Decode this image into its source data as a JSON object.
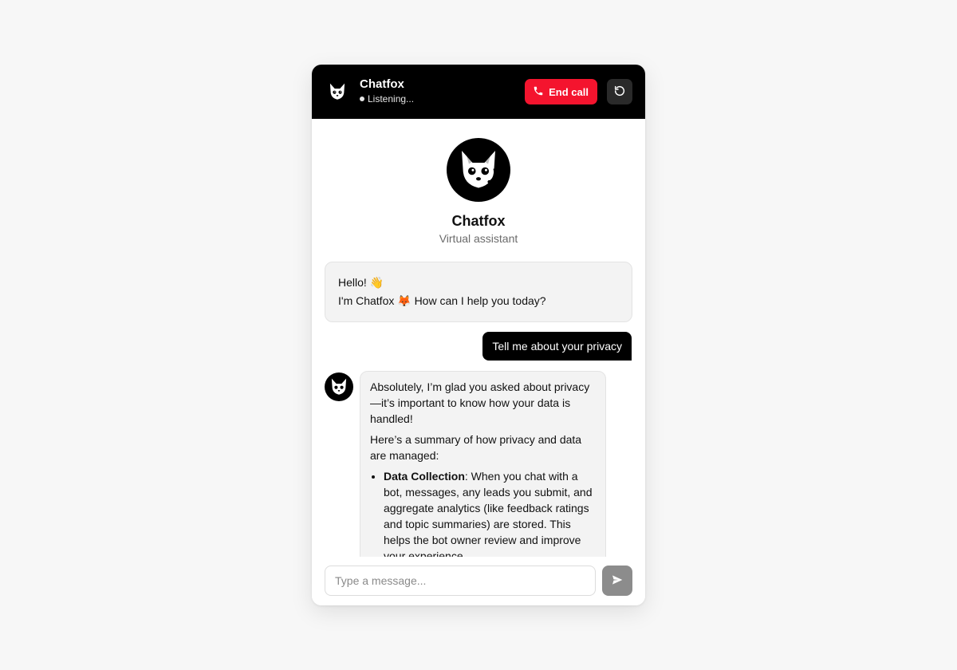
{
  "colors": {
    "header_bg": "#000000",
    "end_call_bg": "#f4142e",
    "user_bubble_bg": "#000000",
    "bot_bubble_bg": "#f3f3f3",
    "send_button_bg": "#8c8c8c",
    "page_bg": "#f7f7f7"
  },
  "header": {
    "title": "Chatfox",
    "status": "Listening...",
    "logo_icon": "fox-mascot-icon",
    "end_call_label": "End call",
    "end_call_icon": "phone-icon",
    "reset_icon": "refresh-icon"
  },
  "profile": {
    "avatar_icon": "fox-mascot-icon",
    "name": "Chatfox",
    "subtitle": "Virtual assistant"
  },
  "messages": [
    {
      "role": "bot",
      "lines": [
        "Hello! 👋",
        "I'm Chatfox 🦊 How can I help you today?"
      ]
    },
    {
      "role": "user",
      "text": "Tell me about your privacy"
    },
    {
      "role": "bot",
      "avatar_icon": "fox-mascot-icon",
      "paragraph_1": "Absolutely, I’m glad you asked about privacy—it’s important to know how your data is handled!",
      "paragraph_2": "Here’s a summary of how privacy and data are managed:",
      "bullets": [
        {
          "bold": "Data Collection",
          "text": ": When you chat with a bot, messages, any leads you submit, and aggregate analytics (like feedback ratings and topic summaries) are stored. This helps the bot owner review and improve your experience."
        }
      ]
    }
  ],
  "composer": {
    "placeholder": "Type a message...",
    "send_icon": "send-icon"
  }
}
